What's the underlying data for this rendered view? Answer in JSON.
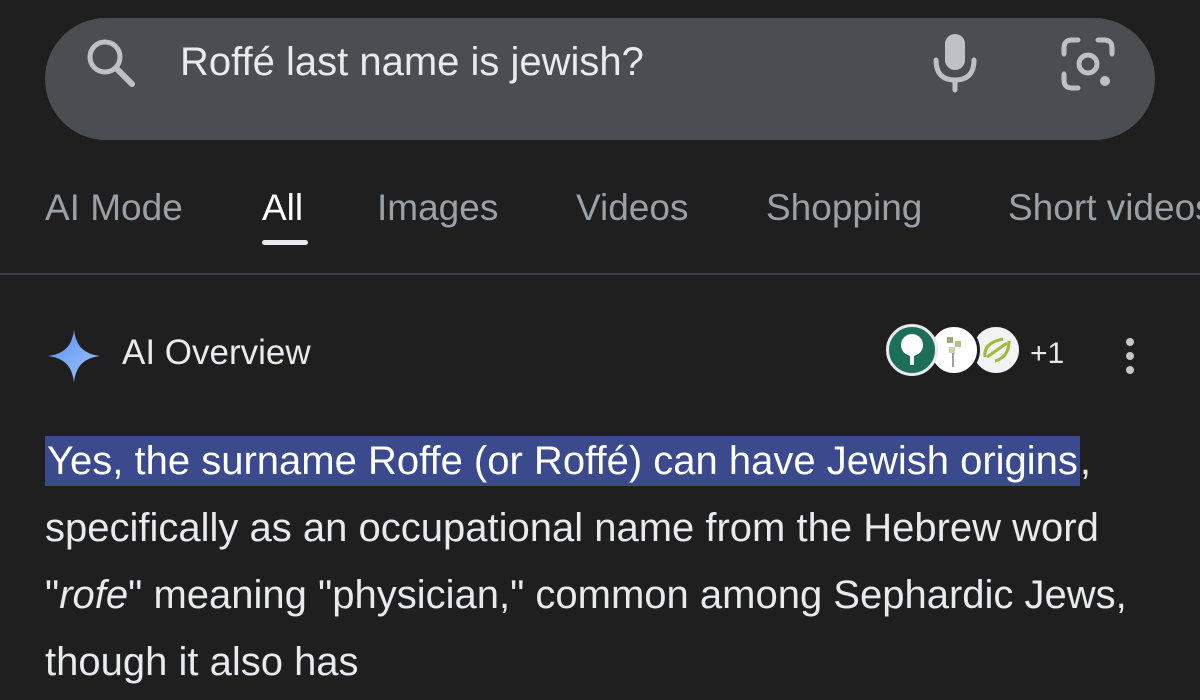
{
  "search": {
    "query": "Roffé last name is jewish?"
  },
  "tabs": [
    {
      "label": "AI Mode",
      "active": false
    },
    {
      "label": "All",
      "active": true
    },
    {
      "label": "Images",
      "active": false
    },
    {
      "label": "Videos",
      "active": false
    },
    {
      "label": "Shopping",
      "active": false
    },
    {
      "label": "Short videos",
      "active": false
    }
  ],
  "ai_overview": {
    "title": "AI Overview",
    "extra_sources": "+1",
    "highlight": "Yes, the surname Roffe (or Roffé) can have Jewish origins",
    "text_1": ", specifically as an occupational name from the Hebrew word \"",
    "italic_word": "rofe",
    "text_2": "\" meaning \"physician,\" common among Sephardic Jews, though it also has"
  },
  "colors": {
    "background": "#1f1f1f",
    "search_bar": "#4a4d51",
    "highlight": "#3b4a8d",
    "sparkle": "#8ab4f8"
  }
}
